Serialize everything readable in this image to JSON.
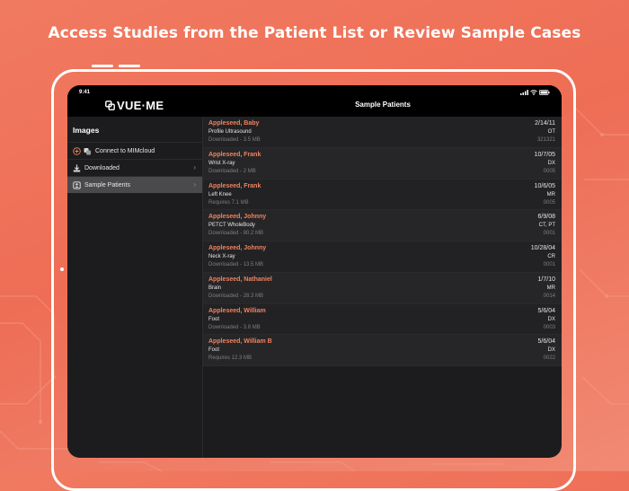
{
  "headline": "Access Studies from the Patient List or Review Sample Cases",
  "status_bar": {
    "time": "9:41"
  },
  "app": {
    "logo": "VUE·ME",
    "title": "Sample Patients"
  },
  "sidebar": {
    "heading": "Images",
    "items": [
      {
        "label": "Connect to MIMcloud",
        "icon": "cloud-connect-icon"
      },
      {
        "label": "Downloaded",
        "icon": "download-icon"
      },
      {
        "label": "Sample Patients",
        "icon": "sample-patients-icon",
        "selected": true
      }
    ]
  },
  "patients": [
    {
      "name": "Appleseed, Baby",
      "study": "Profile Ultrasound",
      "status": "Downloaded - 3.5 MB",
      "date": "2/14/11",
      "modality": "OT",
      "id": "321321"
    },
    {
      "name": "Appleseed, Frank",
      "study": "Wrist X-ray",
      "status": "Downloaded - 2 MB",
      "date": "10/7/05",
      "modality": "DX",
      "id": "0005"
    },
    {
      "name": "Appleseed, Frank",
      "study": "Left Knee",
      "status": "Requires 7.1 MB",
      "date": "10/6/05",
      "modality": "MR",
      "id": "0005"
    },
    {
      "name": "Appleseed, Johnny",
      "study": "PETCT WholeBody",
      "status": "Downloaded - 80.2 MB",
      "date": "6/9/08",
      "modality": "CT, PT",
      "id": "0001"
    },
    {
      "name": "Appleseed, Johnny",
      "study": "Neck X-ray",
      "status": "Downloaded - 13.5 MB",
      "date": "10/28/04",
      "modality": "CR",
      "id": "0001"
    },
    {
      "name": "Appleseed, Nathaniel",
      "study": "Brain",
      "status": "Downloaded - 28.3 MB",
      "date": "1/7/10",
      "modality": "MR",
      "id": "0014"
    },
    {
      "name": "Appleseed, William",
      "study": "Foot",
      "status": "Downloaded - 3.8 MB",
      "date": "5/6/04",
      "modality": "DX",
      "id": "0003"
    },
    {
      "name": "Appleseed, William B",
      "study": "Foot",
      "status": "Requires 12.3 MB",
      "date": "5/6/04",
      "modality": "DX",
      "id": "0022"
    }
  ],
  "colors": {
    "background": "#ee6d55",
    "accent_name": "#f0825e",
    "screen": "#1c1c1e"
  }
}
